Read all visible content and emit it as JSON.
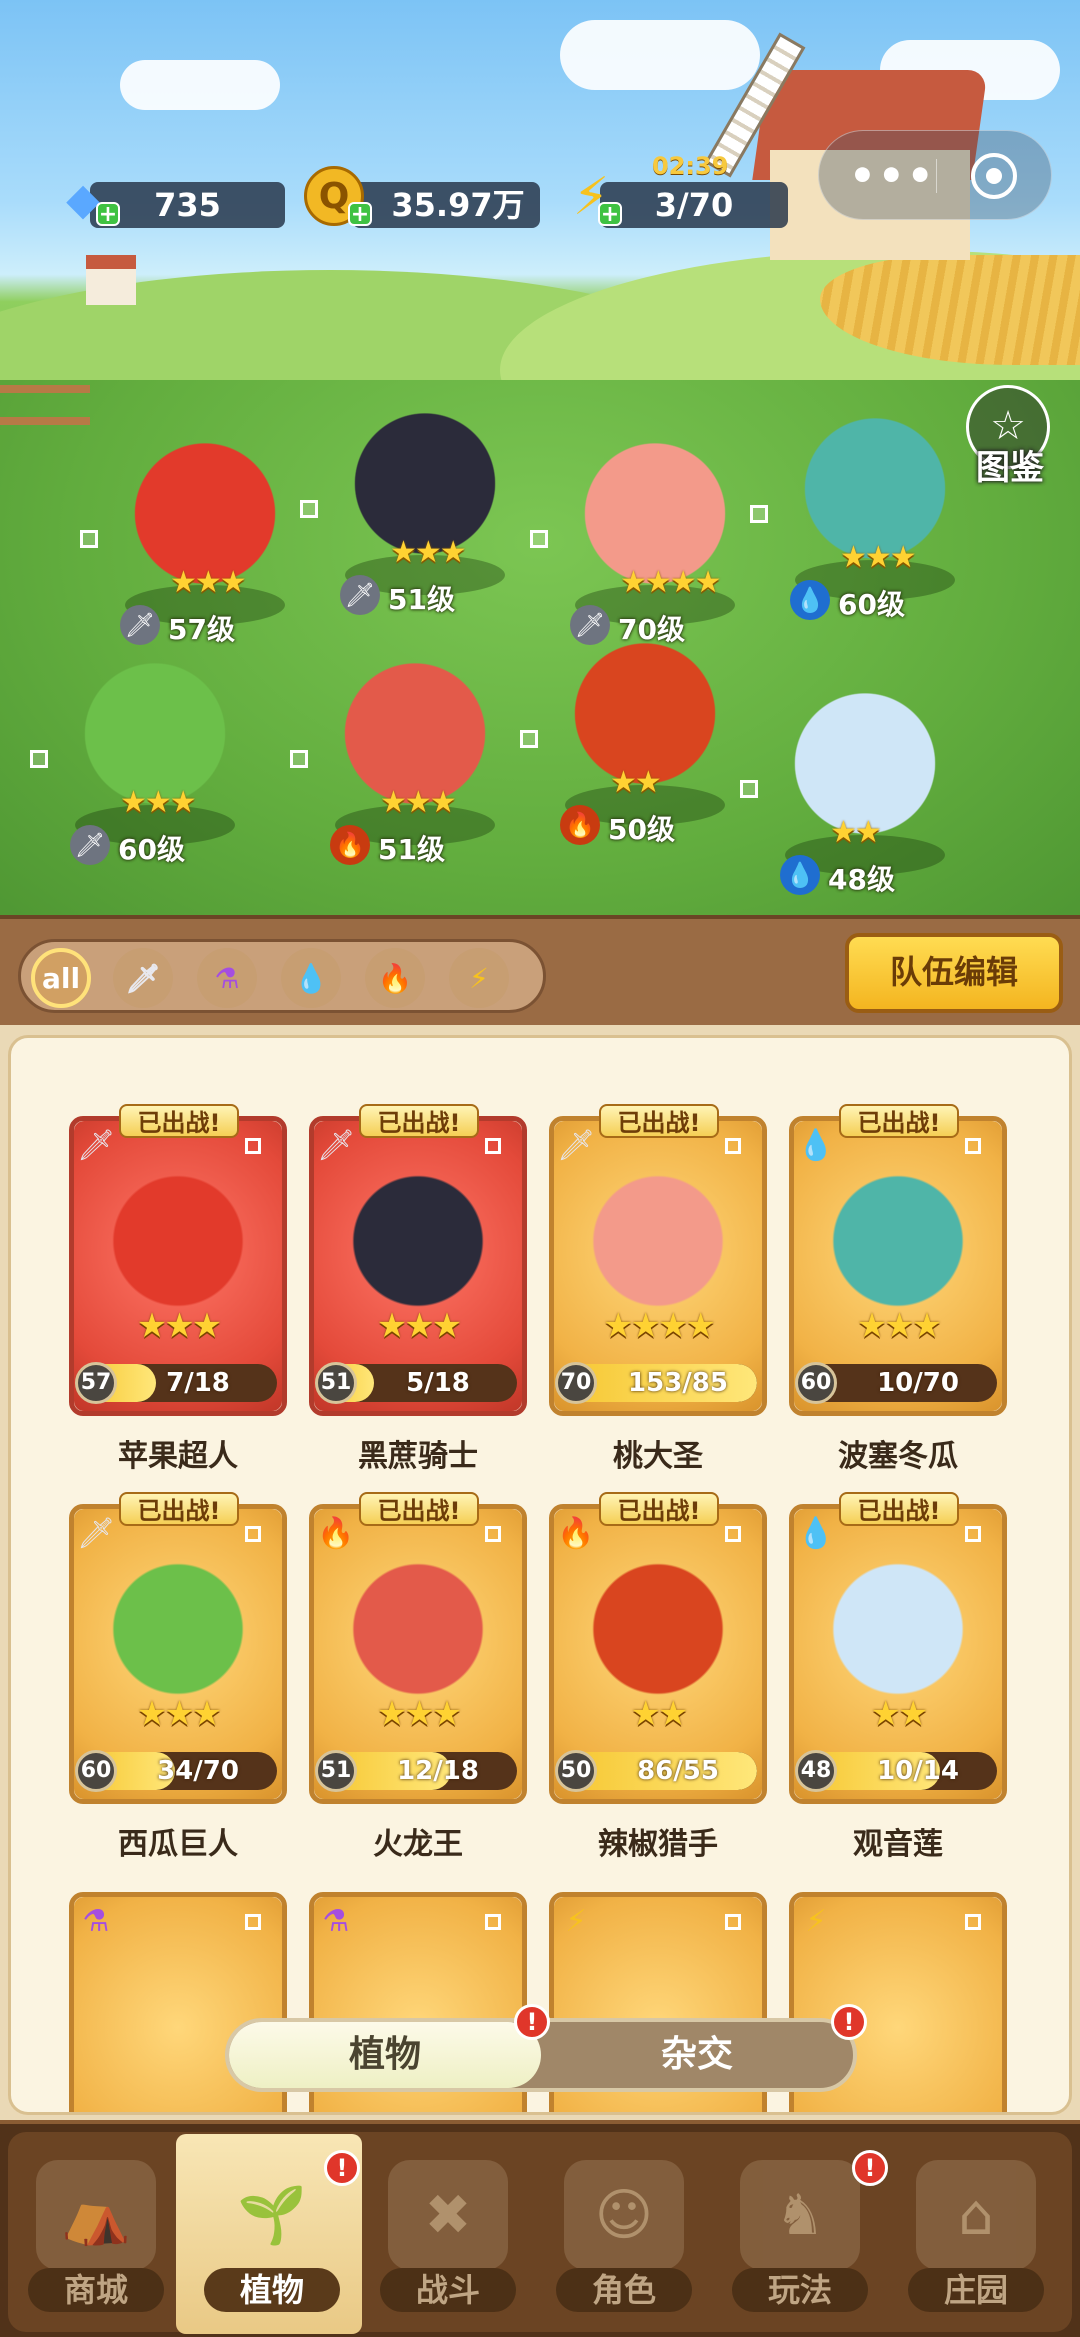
{
  "hud": {
    "gems": "735",
    "coins": "35.97万",
    "energy": "3/70",
    "timer": "02:39"
  },
  "codex_label": "图鉴",
  "field_plants": [
    {
      "level": "57级",
      "element": "sword"
    },
    {
      "level": "51级",
      "element": "sword"
    },
    {
      "level": "70级",
      "element": "sword"
    },
    {
      "level": "60级",
      "element": "water"
    },
    {
      "level": "60级",
      "element": "sword"
    },
    {
      "level": "51级",
      "element": "fire"
    },
    {
      "level": "50级",
      "element": "fire"
    },
    {
      "level": "48级",
      "element": "water"
    }
  ],
  "filters": [
    "all",
    "sword",
    "potion",
    "water",
    "fire",
    "lightning"
  ],
  "team_edit_label": "队伍编辑",
  "cards": [
    {
      "name": "苹果超人",
      "badge": "已出战!",
      "level": "57",
      "progress": "7/18",
      "stars": "★★★",
      "color": "red",
      "element": "sword"
    },
    {
      "name": "黑蔗骑士",
      "badge": "已出战!",
      "level": "51",
      "progress": "5/18",
      "stars": "★★★",
      "color": "red",
      "element": "sword"
    },
    {
      "name": "桃大圣",
      "badge": "已出战!",
      "level": "70",
      "progress": "153/85",
      "stars": "★★★★",
      "color": "gold",
      "element": "sword"
    },
    {
      "name": "波塞冬瓜",
      "badge": "已出战!",
      "level": "60",
      "progress": "10/70",
      "stars": "★★★",
      "color": "gold",
      "element": "water"
    },
    {
      "name": "西瓜巨人",
      "badge": "已出战!",
      "level": "60",
      "progress": "34/70",
      "stars": "★★★",
      "color": "gold",
      "element": "sword"
    },
    {
      "name": "火龙王",
      "badge": "已出战!",
      "level": "51",
      "progress": "12/18",
      "stars": "★★★",
      "color": "gold",
      "element": "fire"
    },
    {
      "name": "辣椒猎手",
      "badge": "已出战!",
      "level": "50",
      "progress": "86/55",
      "stars": "★★",
      "color": "gold",
      "element": "fire"
    },
    {
      "name": "观音莲",
      "badge": "已出战!",
      "level": "48",
      "progress": "10/14",
      "stars": "★★",
      "color": "gold",
      "element": "water"
    }
  ],
  "partial_cards": [
    {
      "element": "potion"
    },
    {
      "element": "potion"
    },
    {
      "element": "lightning"
    },
    {
      "element": "lightning"
    }
  ],
  "tabs": {
    "plants": "植物",
    "hybrid": "杂交",
    "alert": "!"
  },
  "nav": [
    {
      "label": "商城",
      "active": false
    },
    {
      "label": "植物",
      "active": true
    },
    {
      "label": "战斗",
      "active": false
    },
    {
      "label": "角色",
      "active": false
    },
    {
      "label": "玩法",
      "active": false
    },
    {
      "label": "庄园",
      "active": false
    }
  ],
  "colors": {
    "gold_frame": "#c0822e",
    "red_frame": "#b23b2c",
    "alert": "#e0362a",
    "bar_fill": "#f6c630"
  }
}
